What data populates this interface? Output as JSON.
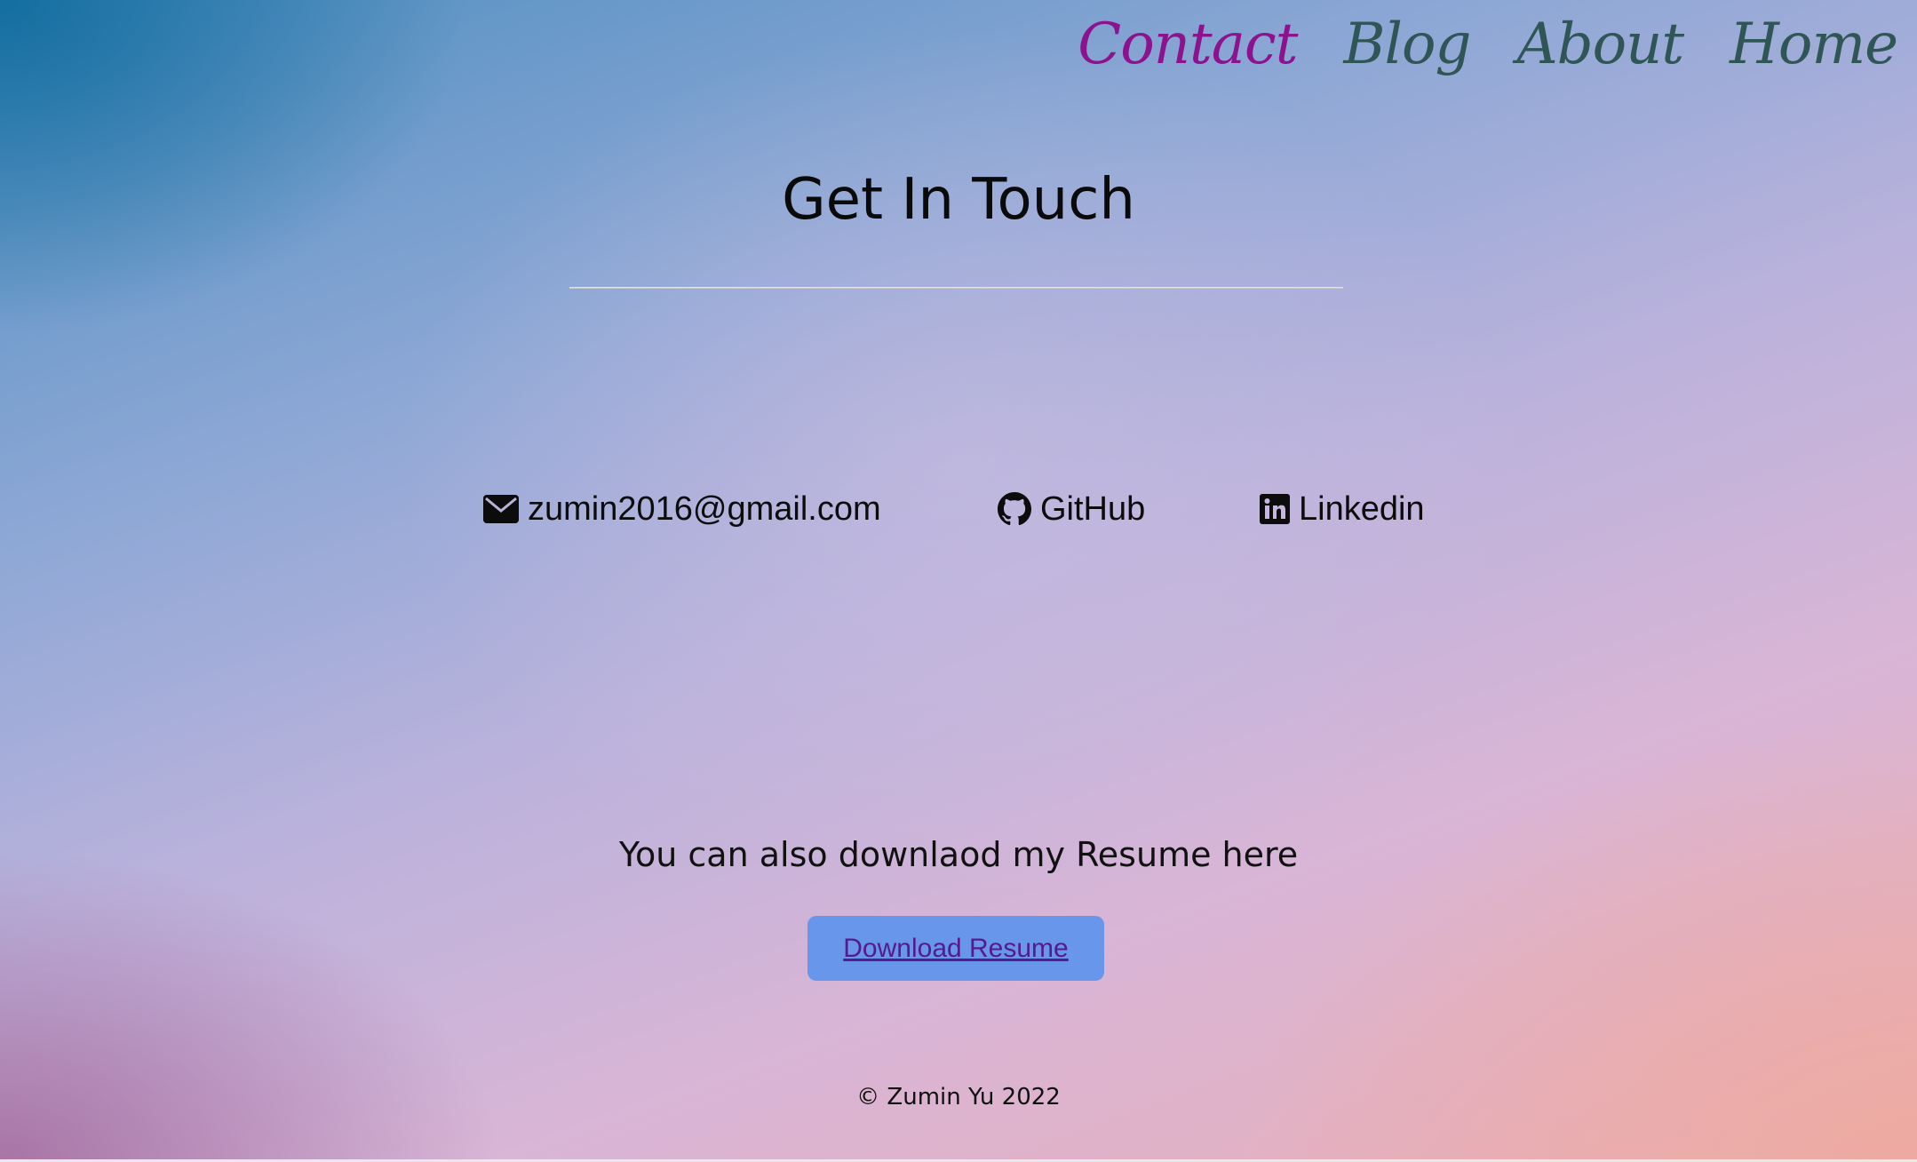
{
  "nav": {
    "items": [
      {
        "label": "Contact",
        "active": true
      },
      {
        "label": "Blog",
        "active": false
      },
      {
        "label": "About",
        "active": false
      },
      {
        "label": "Home",
        "active": false
      }
    ],
    "active_color": "#8c128e",
    "color": "#2f5555"
  },
  "main": {
    "title": "Get In Touch"
  },
  "contacts": {
    "email": {
      "icon": "envelope-icon",
      "label": "zumin2016@gmail.com"
    },
    "github": {
      "icon": "github-icon",
      "label": "GitHub"
    },
    "linkedin": {
      "icon": "linkedin-icon",
      "label": "Linkedin"
    }
  },
  "resume": {
    "text": "You can also downlaod my Resume here",
    "button_label": "Download Resume",
    "button_color": "#6896ea",
    "link_color": "#551a8b"
  },
  "footer": {
    "copyright": "© Zumin Yu 2022"
  }
}
